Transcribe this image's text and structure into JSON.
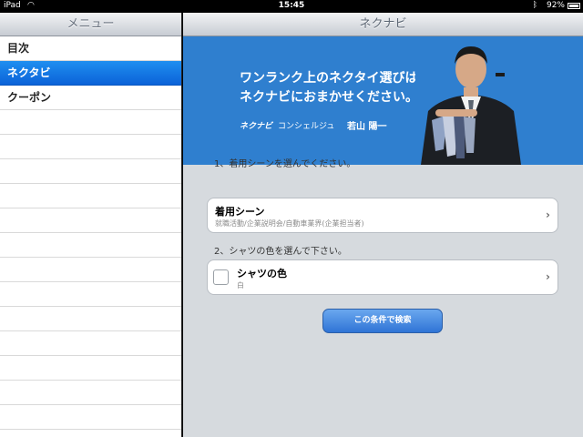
{
  "status_bar": {
    "device": "iPad",
    "time": "15:45",
    "battery": "92%",
    "icons": [
      "wifi-icon",
      "bluetooth-icon",
      "battery-icon"
    ]
  },
  "left_pane": {
    "title": "メニュー",
    "items": [
      {
        "label": "目次",
        "selected": false
      },
      {
        "label": "ネクタビ",
        "selected": true
      },
      {
        "label": "クーポン",
        "selected": false
      }
    ]
  },
  "right_pane": {
    "title": "ネクナビ",
    "banner": {
      "line1": "ワンランク上のネクタイ選びは",
      "line2": "ネクナビにおまかせください。",
      "brand": "ネクナビ",
      "role": "コンシェルジュ",
      "person": "若山 陽一"
    },
    "step1": {
      "label": "1、着用シーンを選んでください。",
      "cell_title": "着用シーン",
      "cell_sub": "就職活動/企業説明会/自動車業界(企業担当者)"
    },
    "step2": {
      "label": "2、シャツの色を選んで下さい。",
      "cell_title": "シャツの色",
      "cell_sub": "白"
    },
    "search_button": "この条件で検索"
  },
  "colors": {
    "banner_blue": "#2f7fcf",
    "selected_blue": "#1f8ff0",
    "pane_bg": "#d6dade"
  }
}
